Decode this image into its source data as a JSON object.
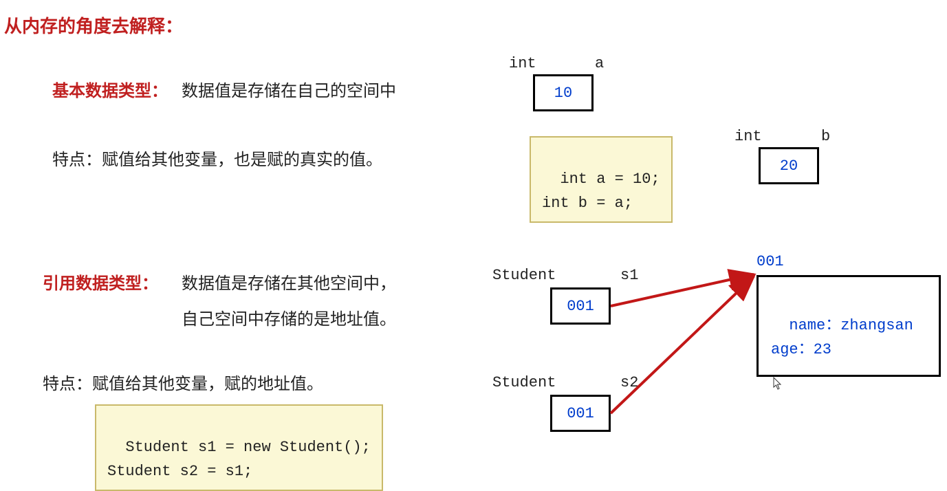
{
  "title": "从内存的角度去解释：",
  "primitive": {
    "label": "基本数据类型：",
    "desc": "数据值是存储在自己的空间中",
    "feature_label": "特点：",
    "feature_text": "赋值给其他变量，也是赋的真实的值。",
    "code": "int a = 10;\nint b = a;",
    "boxA": {
      "type": "int",
      "name": "a",
      "value": "10"
    },
    "boxB": {
      "type": "int",
      "name": "b",
      "value": "20"
    }
  },
  "reference": {
    "label": "引用数据类型：",
    "desc1": "数据值是存储在其他空间中，",
    "desc2": "自己空间中存储的是地址值。",
    "feature_label": "特点：",
    "feature_text": "赋值给其他变量，赋的地址值。",
    "code": "Student s1 = new Student();\nStudent s2 = s1;",
    "s1": {
      "type": "Student",
      "name": "s1",
      "value": "001"
    },
    "s2": {
      "type": "Student",
      "name": "s2",
      "value": "001"
    },
    "obj": {
      "addr": "001",
      "content": "name：zhangsan\nage：23"
    }
  },
  "colors": {
    "red": "#c02020",
    "blue": "#003dcc",
    "codebg": "#fbf8d6"
  }
}
